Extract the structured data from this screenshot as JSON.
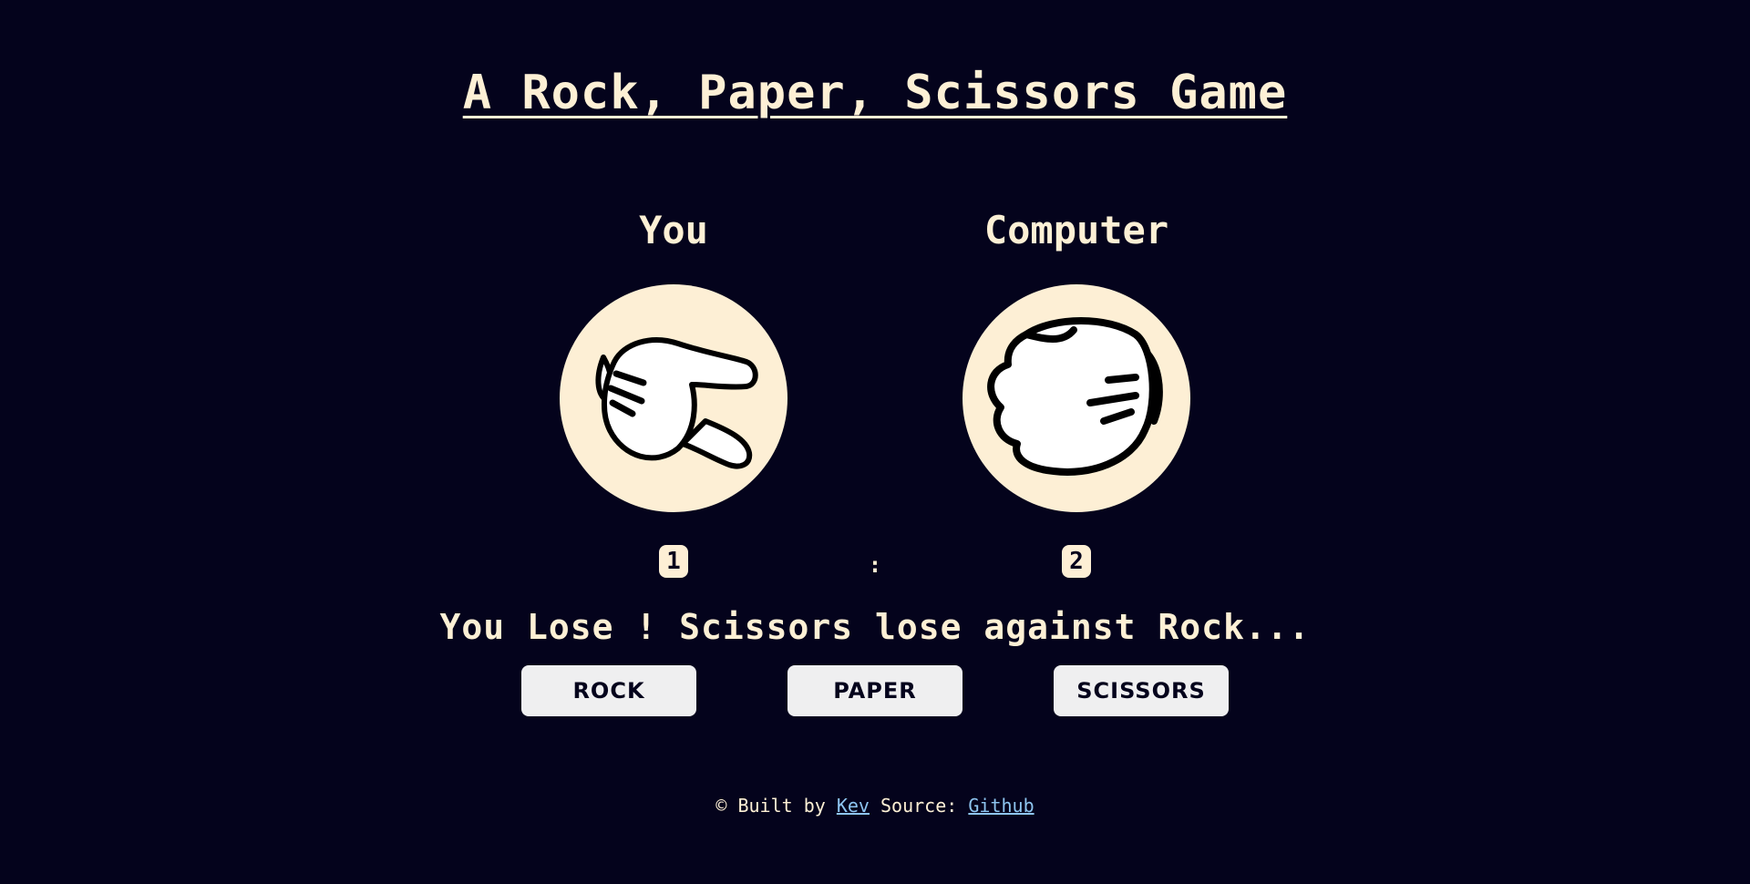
{
  "title": "A Rock, Paper, Scissors Game",
  "players": {
    "you": {
      "label": "You",
      "hand_icon": "scissors-hand-icon",
      "score": "1"
    },
    "computer": {
      "label": "Computer",
      "hand_icon": "rock-fist-icon",
      "score": "2"
    }
  },
  "score_separator": ":",
  "result": "You Lose ! Scissors lose against Rock...",
  "buttons": {
    "rock": "ROCK",
    "paper": "PAPER",
    "scissors": "SCISSORS"
  },
  "footer": {
    "prefix": "© Built by",
    "author": "Kev",
    "source_label": "Source:",
    "source_link": "Github"
  },
  "colors": {
    "background": "#04031c",
    "text": "#fdf0d5",
    "circle": "#fdefd5",
    "button": "#efeff0",
    "link": "#8ec5f0"
  }
}
